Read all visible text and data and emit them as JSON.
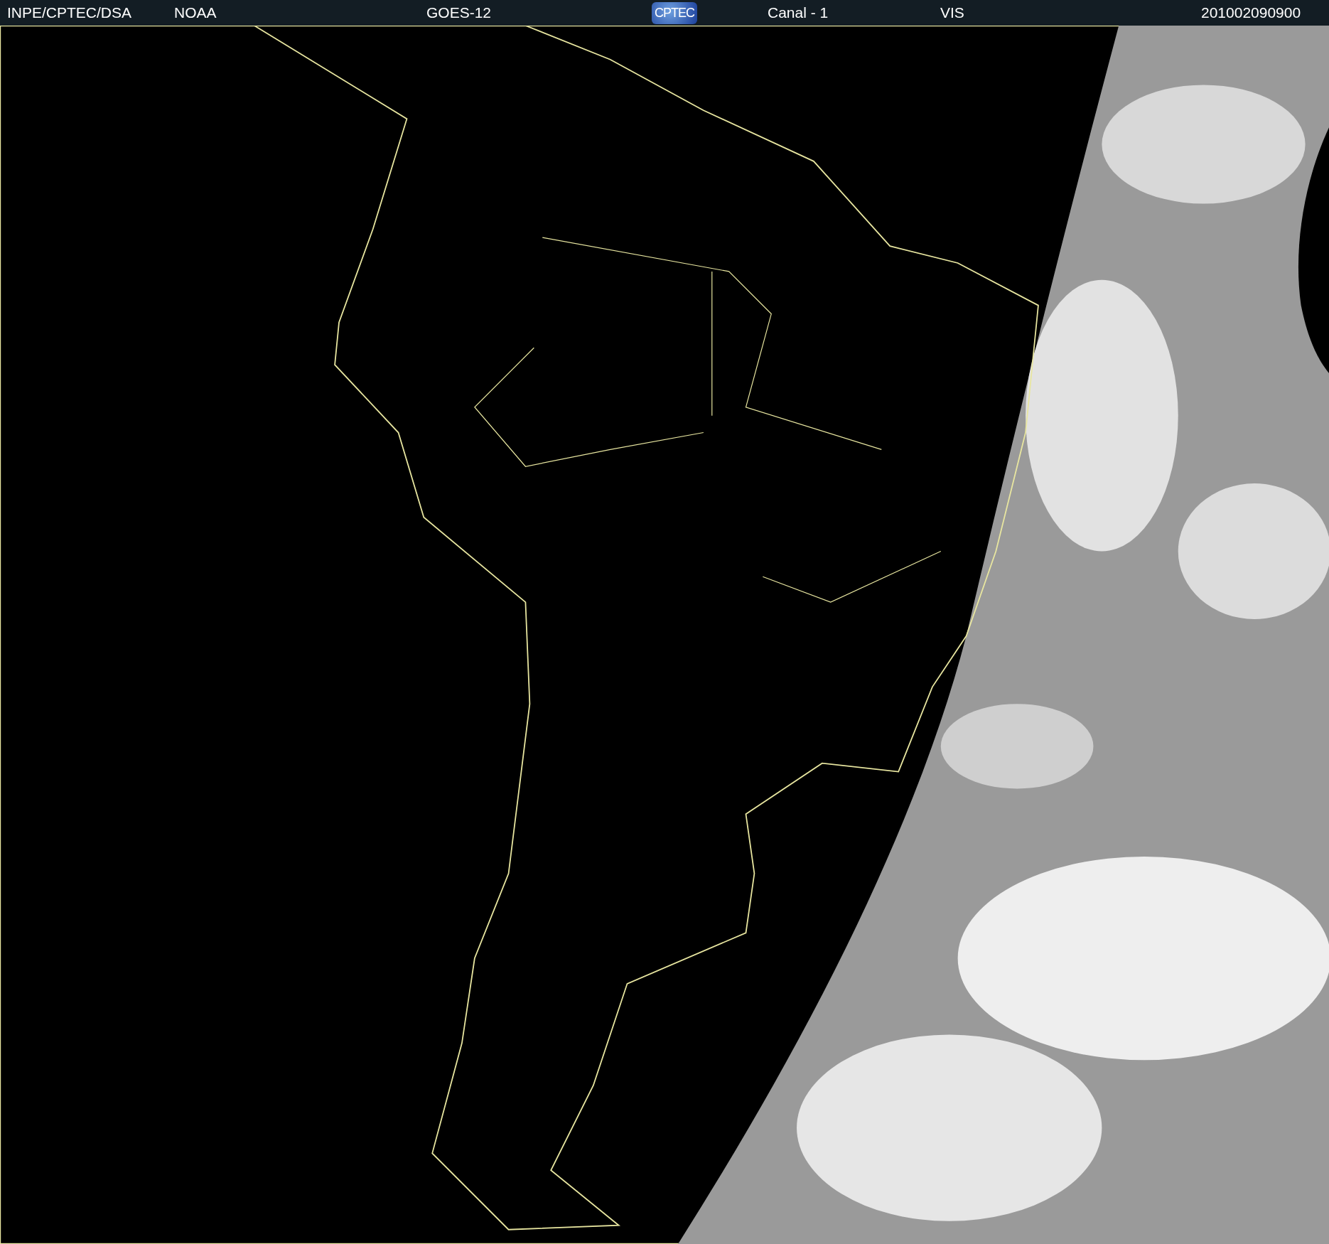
{
  "header": {
    "items": [
      {
        "kind": "text",
        "text": "INPE/CPTEC/DSA"
      },
      {
        "kind": "text",
        "text": "NOAA"
      },
      {
        "kind": "text",
        "text": "GOES-12"
      },
      {
        "kind": "logo",
        "text": "CPTEC"
      },
      {
        "kind": "text",
        "text": "Canal - 1"
      },
      {
        "kind": "text",
        "text": "VIS"
      },
      {
        "kind": "text",
        "text": "201002090900"
      }
    ]
  }
}
